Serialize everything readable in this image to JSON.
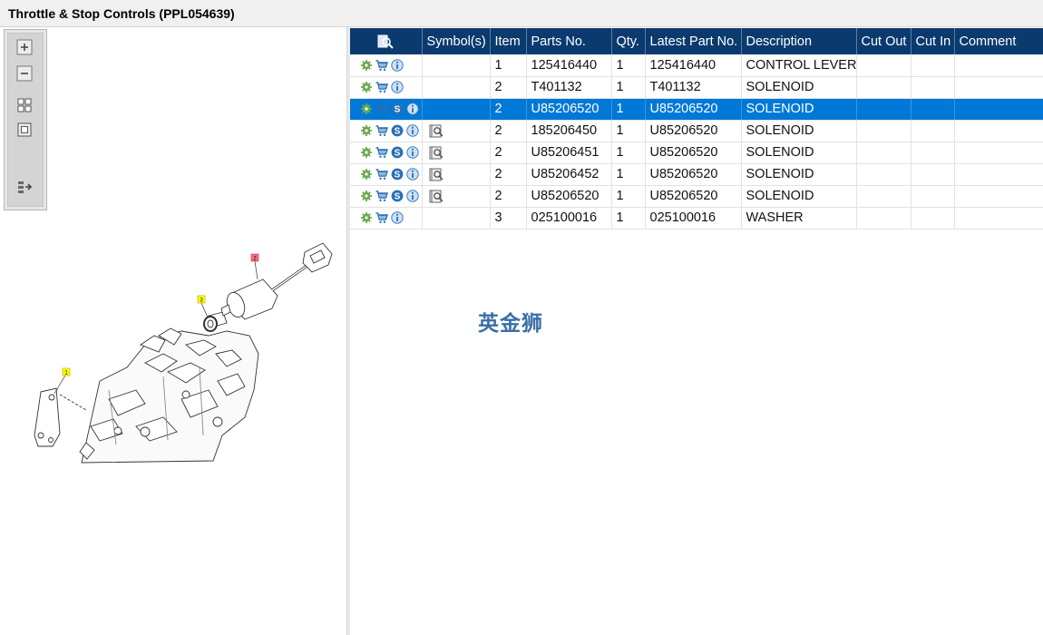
{
  "window": {
    "title": "Throttle & Stop Controls (PPL054639)"
  },
  "toolbar": {
    "buttons": [
      "zoom-in",
      "zoom-out",
      "fit-all",
      "actual-size",
      "export"
    ]
  },
  "drawing": {
    "callouts": [
      {
        "label": "1",
        "color": "#ffff00"
      },
      {
        "label": "2",
        "color": "#ff6f7f"
      },
      {
        "label": "3",
        "color": "#ffff00"
      }
    ]
  },
  "table": {
    "columns": [
      "Symbol(s)",
      "Item",
      "Parts No.",
      "Qty.",
      "Latest Part No.",
      "Description",
      "Cut Out",
      "Cut In",
      "Comment"
    ],
    "rows": [
      {
        "icons": [
          "gear",
          "cart",
          "info"
        ],
        "symbol": false,
        "item": "1",
        "part_no": "125416440",
        "qty": "1",
        "latest": "125416440",
        "desc": "CONTROL LEVER",
        "cut_out": "",
        "cut_in": "",
        "comment": "",
        "selected": false
      },
      {
        "icons": [
          "gear",
          "cart",
          "info"
        ],
        "symbol": false,
        "item": "2",
        "part_no": "T401132",
        "qty": "1",
        "latest": "T401132",
        "desc": "SOLENOID",
        "cut_out": "",
        "cut_in": "",
        "comment": "",
        "selected": false
      },
      {
        "icons": [
          "gear",
          "cart",
          "s",
          "info"
        ],
        "symbol": false,
        "item": "2",
        "part_no": "U85206520",
        "qty": "1",
        "latest": "U85206520",
        "desc": "SOLENOID",
        "cut_out": "",
        "cut_in": "",
        "comment": "",
        "selected": true
      },
      {
        "icons": [
          "gear",
          "cart",
          "s",
          "info"
        ],
        "symbol": true,
        "item": "2",
        "part_no": "185206450",
        "qty": "1",
        "latest": "U85206520",
        "desc": "SOLENOID",
        "cut_out": "",
        "cut_in": "",
        "comment": "",
        "selected": false
      },
      {
        "icons": [
          "gear",
          "cart",
          "s",
          "info"
        ],
        "symbol": true,
        "item": "2",
        "part_no": "U85206451",
        "qty": "1",
        "latest": "U85206520",
        "desc": "SOLENOID",
        "cut_out": "",
        "cut_in": "",
        "comment": "",
        "selected": false
      },
      {
        "icons": [
          "gear",
          "cart",
          "s",
          "info"
        ],
        "symbol": true,
        "item": "2",
        "part_no": "U85206452",
        "qty": "1",
        "latest": "U85206520",
        "desc": "SOLENOID",
        "cut_out": "",
        "cut_in": "",
        "comment": "",
        "selected": false
      },
      {
        "icons": [
          "gear",
          "cart",
          "s",
          "info"
        ],
        "symbol": true,
        "item": "2",
        "part_no": "U85206520",
        "qty": "1",
        "latest": "U85206520",
        "desc": "SOLENOID",
        "cut_out": "",
        "cut_in": "",
        "comment": "",
        "selected": false
      },
      {
        "icons": [
          "gear",
          "cart",
          "info"
        ],
        "symbol": false,
        "item": "3",
        "part_no": "025100016",
        "qty": "1",
        "latest": "025100016",
        "desc": "WASHER",
        "cut_out": "",
        "cut_in": "",
        "comment": "",
        "selected": false
      }
    ]
  },
  "watermark": "英金狮",
  "colors": {
    "header": "#0a3a6e",
    "selected": "#0078d7",
    "gear": "#6aa84f",
    "cart": "#2a6fb5",
    "info": "#3d7fc4"
  }
}
